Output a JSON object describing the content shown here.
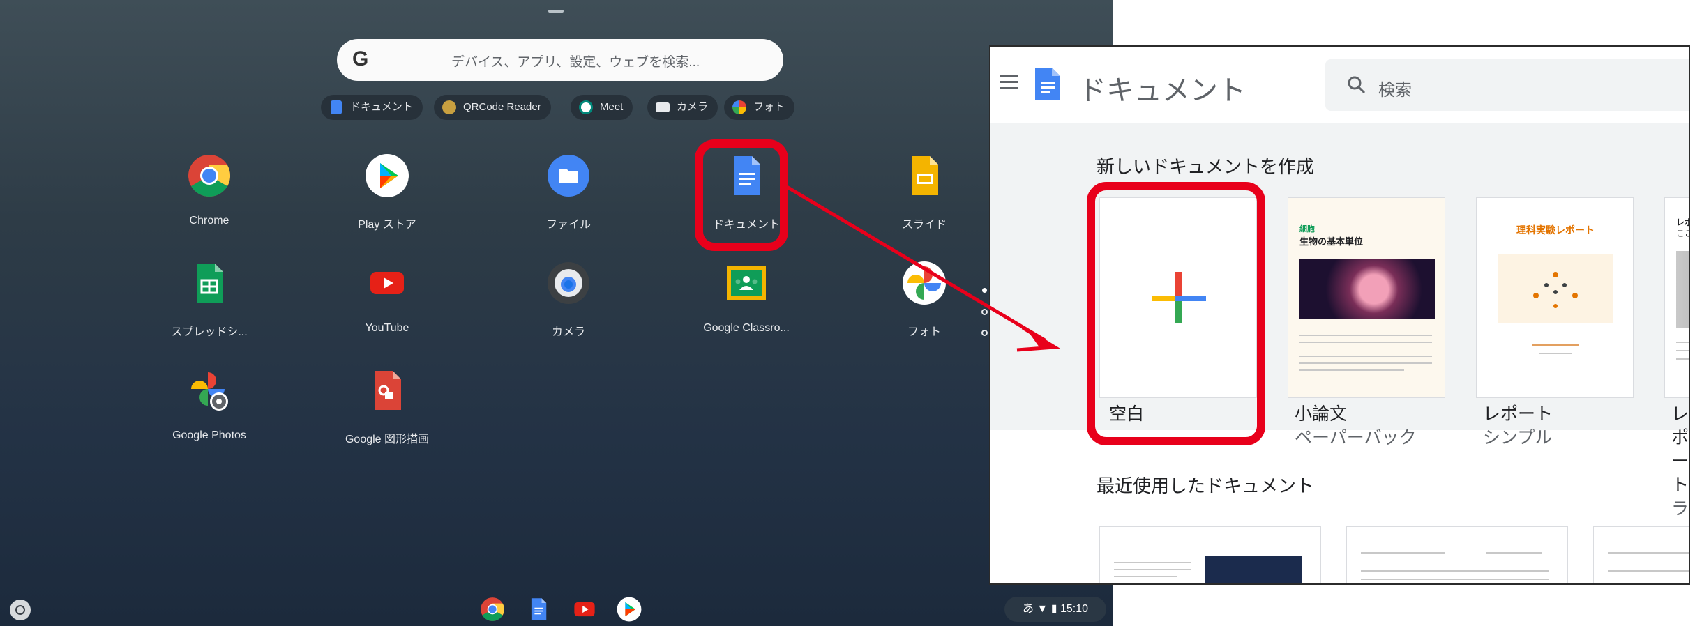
{
  "launcher": {
    "search_placeholder": "デバイス、アプリ、設定、ウェブを検索...",
    "search_logo": "G",
    "suggestion_chips": [
      {
        "label": "ドキュメント",
        "icon": "docs-icon"
      },
      {
        "label": "QRCode Reader",
        "icon": "qrcode-icon"
      },
      {
        "label": "Meet",
        "icon": "meet-icon"
      },
      {
        "label": "カメラ",
        "icon": "camera-icon"
      },
      {
        "label": "フォト",
        "icon": "photos-icon"
      }
    ],
    "apps": [
      {
        "label": "Chrome",
        "icon": "chrome-icon"
      },
      {
        "label": "Play ストア",
        "icon": "play-store-icon"
      },
      {
        "label": "ファイル",
        "icon": "files-icon"
      },
      {
        "label": "ドキュメント",
        "icon": "docs-icon"
      },
      {
        "label": "スライド",
        "icon": "slides-icon"
      },
      {
        "label": "スプレッドシ...",
        "icon": "sheets-icon"
      },
      {
        "label": "YouTube",
        "icon": "youtube-icon"
      },
      {
        "label": "カメラ",
        "icon": "camera-icon"
      },
      {
        "label": "Google Classro...",
        "icon": "classroom-icon"
      },
      {
        "label": "フォト",
        "icon": "photos-pinwheel-icon"
      },
      {
        "label": "Google Photos",
        "icon": "google-photos-icon"
      },
      {
        "label": "Google 図形描画",
        "icon": "drawings-icon"
      }
    ],
    "shelf_apps": [
      "chrome-icon",
      "docs-icon",
      "youtube-icon",
      "play-store-icon"
    ],
    "status": {
      "ime": "あ",
      "time": "15:10"
    }
  },
  "docs": {
    "title": "ドキュメント",
    "search_placeholder": "検索",
    "new_doc_heading": "新しいドキュメントを作成",
    "templates": [
      {
        "label": "空白",
        "sub": ""
      },
      {
        "label": "小論文",
        "sub": "ペーパーバック"
      },
      {
        "label": "レポート",
        "sub": "シンプル"
      },
      {
        "label": "レポート",
        "sub": "ラックス"
      }
    ],
    "template_previews": {
      "essay_heading_1": "細胞",
      "essay_heading_2": "生物の基本単位",
      "report_heading": "理科実験レポート",
      "lux_heading_1": "レポートの",
      "lux_heading_2": "ここにテキ"
    },
    "recent_heading": "最近使用したドキュメント"
  },
  "colors": {
    "highlight": "#e8001b",
    "docs_blue": "#4285f4",
    "brand_red": "#ea4335",
    "brand_yellow": "#fbbc04",
    "brand_green": "#34a853"
  }
}
